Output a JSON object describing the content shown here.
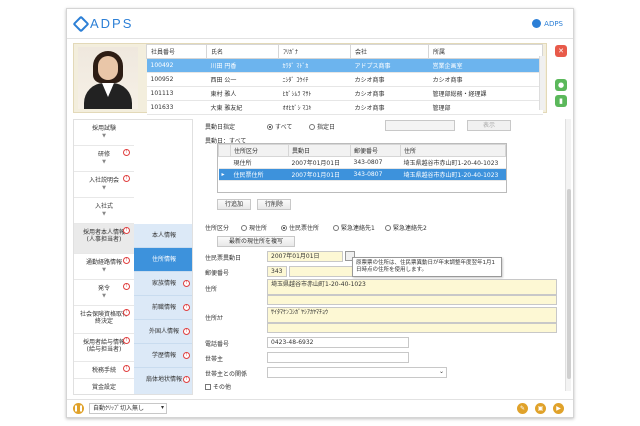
{
  "app": {
    "logo": "ADPS",
    "user": "ADPS"
  },
  "employees": {
    "headers": [
      "社員番号",
      "氏名",
      "ﾌﾘｶﾞﾅ",
      "会社",
      "所属"
    ],
    "rows": [
      [
        "100492",
        "川田 円香",
        "ｶﾜﾀﾞ ﾏﾄﾞｶ",
        "アドプス商事",
        "営業企画室"
      ],
      [
        "100952",
        "西田 公一",
        "ﾆｼﾀﾞ ｺｳｲﾁ",
        "カシオ商事",
        "カシオ商事"
      ],
      [
        "101113",
        "東村 雅人",
        "ﾋｶﾞｼﾑﾗ ﾏｻﾄ",
        "カシオ商事",
        "管理部総務・経理課"
      ],
      [
        "101633",
        "大東 雅友紀",
        "ｵｵﾋｶﾞｼ ﾏﾕｷ",
        "カシオ商事",
        "管理部"
      ]
    ]
  },
  "nav": {
    "left": [
      {
        "label": "採用試験"
      },
      {
        "label": "研修"
      },
      {
        "label": "入社説明会"
      },
      {
        "label": "入社式"
      },
      {
        "label": "採用者本人情報\n(人事担当者)"
      },
      {
        "label": "通勤経路情報"
      },
      {
        "label": "発令"
      },
      {
        "label": "社会保険資格取得\n終決定"
      },
      {
        "label": "採用者給与情報\n(給与担当者)"
      },
      {
        "label": "税務手続"
      },
      {
        "label": "賞金設定"
      }
    ],
    "right": [
      {
        "label": "本人情報"
      },
      {
        "label": "住所情報"
      },
      {
        "label": "家族情報"
      },
      {
        "label": "前職情報"
      },
      {
        "label": "外国人情報"
      },
      {
        "label": "学歴情報"
      },
      {
        "label": "扇体地状情報"
      }
    ]
  },
  "form": {
    "change_date_label": "異動日指定",
    "radio_all": "すべて",
    "radio_specified": "指定日",
    "change_date_display": "異動日：すべて",
    "right_button": "表示",
    "address_table": {
      "headers": [
        "住所区分",
        "異動日",
        "郵便番号",
        "住所"
      ],
      "rows": [
        [
          "現住所",
          "2007年01月01日",
          "343-0807",
          "埼玉県越谷市赤山町1-20-40-1023"
        ],
        [
          "住民票住所",
          "2007年01月01日",
          "343-0807",
          "埼玉県越谷市赤山町1-20-40-1023"
        ]
      ]
    },
    "add_row": "行追加",
    "delete_row": "行削除",
    "address_type_label": "住所区分",
    "address_types": [
      "現住所",
      "住民票住所",
      "緊急連絡先1",
      "緊急連絡先2"
    ],
    "copy_button": "最新の現住所を複写",
    "resident_date_label": "住民票異動日",
    "resident_date_value": "2007年01月01日",
    "postal_label": "郵便番号",
    "postal_value": "343",
    "tooltip": "原票票の住所は、住民票異動日が年末調整年度翌年1月1日時点の住所を使用します。",
    "address_label": "住所",
    "address_value": "埼玉県越谷市赤山町1-20-40-1023",
    "kana_label": "住所ｶﾅ",
    "kana_value": "ｻｲﾀﾏｹﾝｺｼｶﾞﾔｼｱｶﾔﾏﾁｮｳ",
    "phone_label": "電話番号",
    "phone_value": "0423-48-6932",
    "householder_label": "世帯主",
    "relation_label": "世帯主との関係",
    "other_label": "その他"
  },
  "bottom": {
    "select_value": "自動ｸﾘｯﾌﾟ切入無し"
  },
  "colors": {
    "accent": "#3d92dc",
    "selected_row": "#6cb4ee",
    "badge": "#e04040",
    "yellow_field": "#fdf8d4"
  }
}
